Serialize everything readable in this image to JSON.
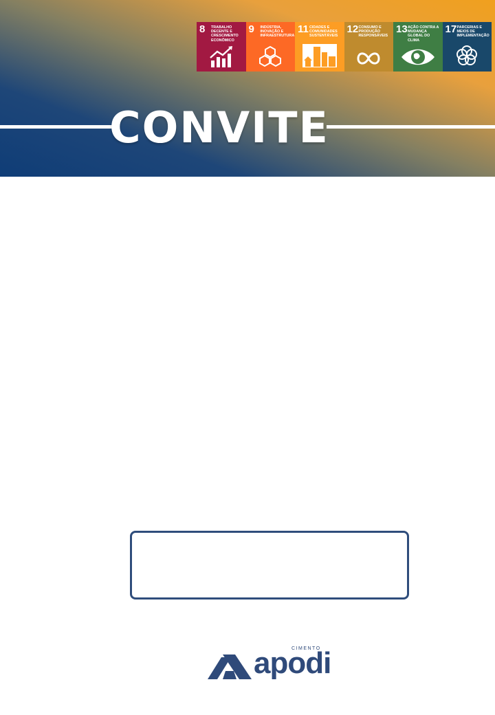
{
  "header": {
    "title": "CONVITE"
  },
  "sdgs": [
    {
      "number": "8",
      "label": "TRABALHO DECENTE E CRESCIMENTO ECONÔMICO",
      "color": "#a21942",
      "icon": "growth-chart-icon"
    },
    {
      "number": "9",
      "label": "INDÚSTRIA, INOVAÇÃO E INFRAESTRUTURA",
      "color": "#fd6925",
      "icon": "cubes-icon"
    },
    {
      "number": "11",
      "label": "CIDADES E COMUNIDADES SUSTENTÁVEIS",
      "color": "#fd9d24",
      "icon": "buildings-icon"
    },
    {
      "number": "12",
      "label": "CONSUMO E PRODUÇÃO RESPONSÁVEIS",
      "color": "#bf8b2e",
      "icon": "infinity-icon"
    },
    {
      "number": "13",
      "label": "AÇÃO CONTRA A MUDANÇA GLOBAL DO CLIMA",
      "color": "#3f7e44",
      "icon": "eye-globe-icon"
    },
    {
      "number": "17",
      "label": "PARCERIAS E MEIOS DE IMPLEMENTAÇÃO",
      "color": "#19486a",
      "icon": "rings-icon"
    }
  ],
  "logo": {
    "small_text": "CIMENTO",
    "word": "apodi",
    "color": "#2f4a7a"
  }
}
